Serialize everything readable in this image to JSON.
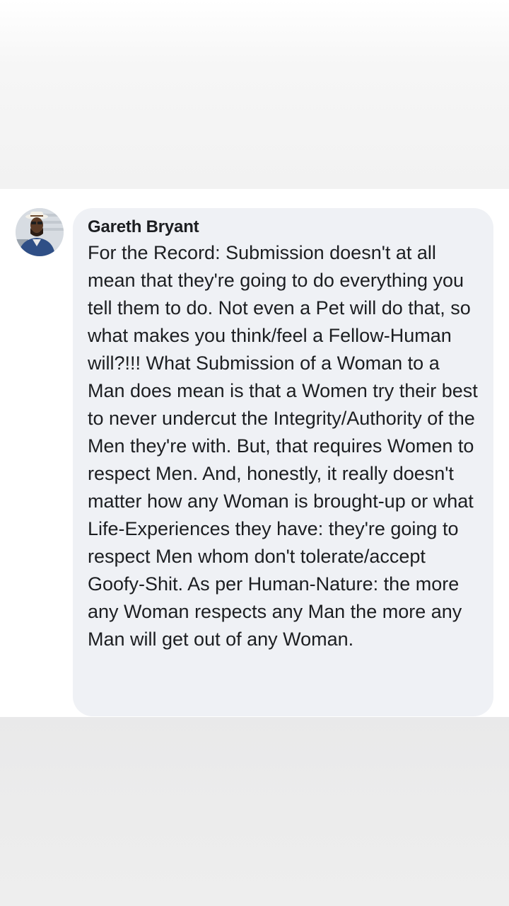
{
  "comment": {
    "author": "Gareth Bryant",
    "text": "For the Record: Submission doesn't at all mean that they're going to do everything you tell them to do. Not even a Pet will do that, so what makes you think/feel a Fellow-Human will?!!! What Submission of a Woman to a Man does mean is that a Women try their best to never undercut the Integrity/Authority of the Men they're with. But, that requires Women to respect Men. And, honestly, it really doesn't matter how any Woman is brought-up or what Life-Experiences they have: they're going to respect Men whom don't tolerate/accept Goofy-Shit. As per Human-Nature: the more any Woman respects any Man the more any Man will get out of any Woman.",
    "avatar_icon": "profile-photo"
  },
  "colors": {
    "bubble_background": "#eff1f5",
    "text": "#1c1e21",
    "top_band": "#f2f2f2",
    "bottom_band": "#eaeaeb"
  }
}
